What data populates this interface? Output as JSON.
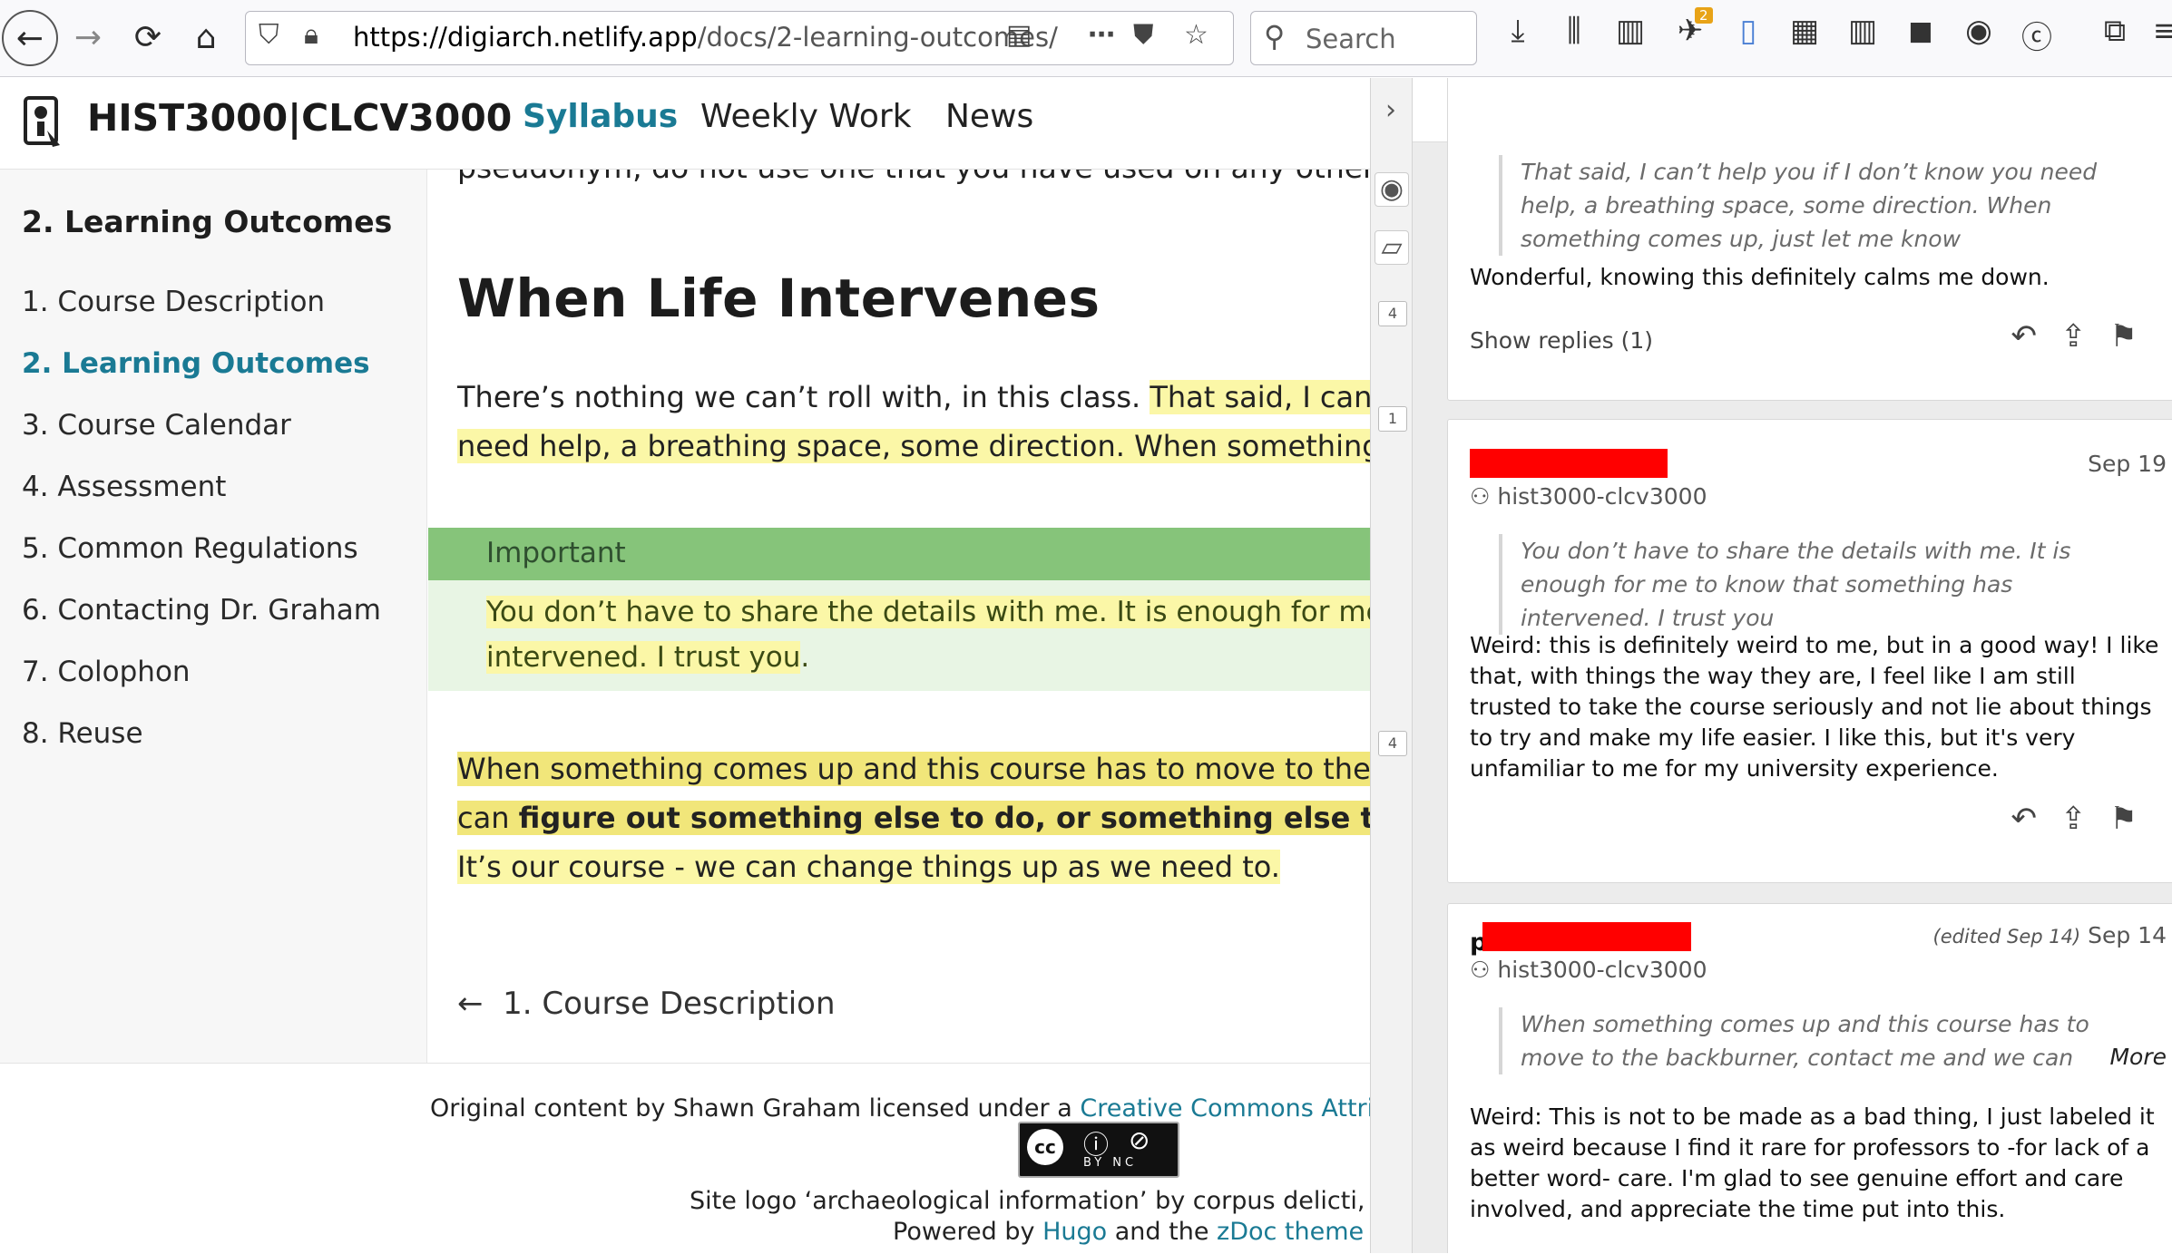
{
  "browser": {
    "url_host": "https://digiarch.netlify.app",
    "url_path": "/docs/2-learning-outcomes/",
    "search_placeholder": "Search",
    "notification_count": "2"
  },
  "site": {
    "title": "HIST3000|CLCV3000",
    "nav": [
      "Syllabus",
      "Weekly Work",
      "News"
    ]
  },
  "sidebar": {
    "heading": "2. Learning Outcomes",
    "items": [
      {
        "label": "1. Course Description"
      },
      {
        "label": "2. Learning Outcomes"
      },
      {
        "label": "3. Course Calendar"
      },
      {
        "label": "4. Assessment"
      },
      {
        "label": "5. Common Regulations"
      },
      {
        "label": "6. Contacting Dr. Graham"
      },
      {
        "label": "7. Colophon"
      },
      {
        "label": "8. Reuse"
      }
    ]
  },
  "content": {
    "cut_line": "pseudonym, do not use one that you have used on any other website",
    "heading": "When Life Intervenes",
    "p1_line1_plain": "There’s nothing we can’t roll with, in this class. ",
    "p1_line1_hl": "That said, I can’t help y",
    "p1_line2_hl": "need help, a breathing space, some direction. When something comes",
    "callout_title": "Important",
    "callout_line1": "You don’t have to share the details with me. It is enough for me to know",
    "callout_line2": "intervened. I trust you",
    "callout_line2_end": ".",
    "p2_line1": "When something comes up and this course has to move to the backbu",
    "p2_line2_plain": "can ",
    "p2_line2_bold": "figure out something else to do, or something else that will help",
    "p2_line3": "It’s our course - we can change things up as we need to.",
    "prev_link": "1. Course Description"
  },
  "footer": {
    "line1_plain": "Original content by Shawn Graham licensed under a ",
    "line1_link": "Creative Commons Attribution-NonC",
    "cc_badge": "BY NC",
    "line2": "Site logo ‘archaeological information’ by corpus delicti, GR, The No",
    "line3_plain1": "Powered by ",
    "line3_link1": "Hugo",
    "line3_plain2": " and the ",
    "line3_link2": "zDoc theme"
  },
  "hypothesis": {
    "group": "hist3000-clcv3000",
    "strip_counts": [
      "4",
      "1",
      "4"
    ],
    "card1": {
      "quote": "That said, I can’t help you if I don’t know you need help, a breathing space, some direction. When something comes up, just let me know",
      "text": "Wonderful, knowing this definitely calms me down.",
      "show_replies": "Show replies (1)"
    },
    "card2": {
      "date": "Sep 19",
      "group": "hist3000-clcv3000",
      "quote": "You don’t have to share the details with me. It is enough for me to know that something has intervened. I trust you",
      "text": "Weird: this is definitely weird to me, but in a good way! I like that, with things the way they are, I feel like I am still trusted to take the course seriously and not lie about things to try and make my life easier. I like this, but it's very unfamiliar to me for my university experience."
    },
    "card3": {
      "author_initial": "p",
      "edited": "(edited Sep 14)",
      "date": "Sep 14",
      "group": "hist3000-clcv3000",
      "quote": "When something comes up and this course has to move to the backburner, contact me and we can figure out someth",
      "more": "More",
      "text": "Weird: This is not to be made as a bad thing, I just labeled it as weird because I find it rare for professors to -for lack of a better word- care. I'm glad to see genuine effort and care involved, and appreciate the time put into this."
    }
  }
}
